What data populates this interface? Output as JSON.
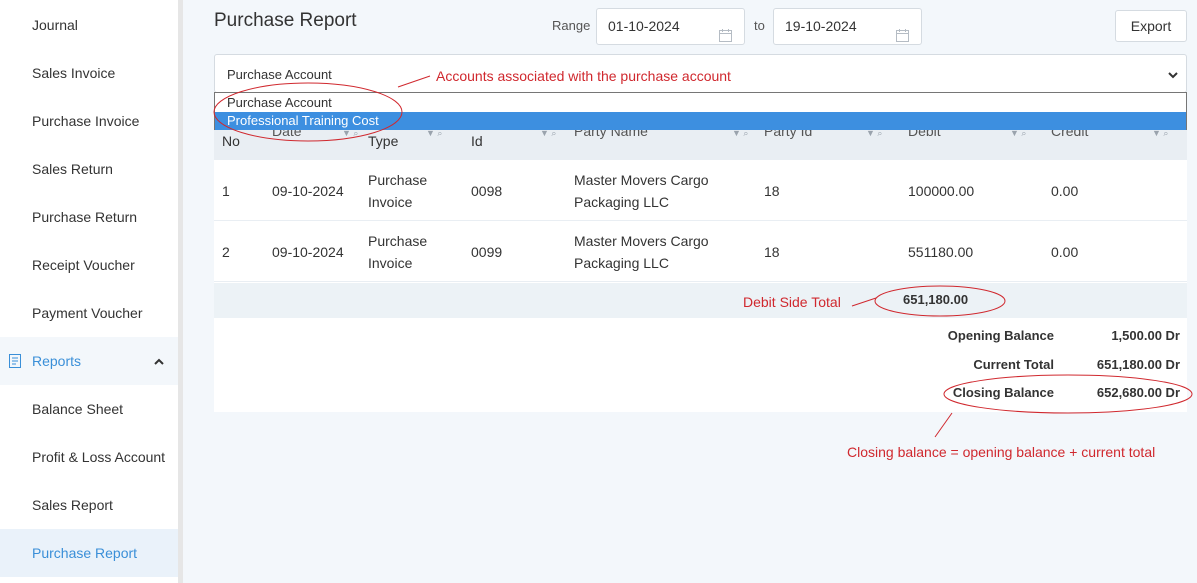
{
  "sidebar": {
    "items": [
      {
        "label": "Journal"
      },
      {
        "label": "Sales Invoice"
      },
      {
        "label": "Purchase Invoice"
      },
      {
        "label": "Sales Return"
      },
      {
        "label": "Purchase Return"
      },
      {
        "label": "Receipt Voucher"
      },
      {
        "label": "Payment Voucher"
      }
    ],
    "reports": {
      "label": "Reports",
      "icon": "report-icon",
      "expanded_icon": "chevron-up-icon"
    },
    "report_items": [
      {
        "label": "Balance Sheet"
      },
      {
        "label": "Profit & Loss Account"
      },
      {
        "label": "Sales Report"
      },
      {
        "label": "Purchase Report",
        "active": true
      }
    ]
  },
  "header": {
    "title": "Purchase Report",
    "range_label": "Range",
    "from_date": "01-10-2024",
    "to_label": "to",
    "to_date": "19-10-2024",
    "export_label": "Export"
  },
  "account_select": {
    "selected": "Purchase Account",
    "options": [
      "Purchase Account",
      "Professional Training Cost"
    ],
    "highlighted": "Professional Training Cost"
  },
  "table": {
    "columns": [
      "No",
      "Date",
      "Type",
      "Id",
      "Party Name",
      "Party Id",
      "Debit",
      "Credit"
    ],
    "rows": [
      {
        "no": "1",
        "date": "09-10-2024",
        "type_1": "Purchase",
        "type_2": "Invoice",
        "id": "0098",
        "party_1": "Master Movers Cargo",
        "party_2": "Packaging LLC",
        "party_id": "18",
        "debit": "100000.00",
        "credit": "0.00"
      },
      {
        "no": "2",
        "date": "09-10-2024",
        "type_1": "Purchase",
        "type_2": "Invoice",
        "id": "0099",
        "party_1": "Master Movers Cargo",
        "party_2": "Packaging LLC",
        "party_id": "18",
        "debit": "551180.00",
        "credit": "0.00"
      }
    ],
    "debit_total": "651,180.00"
  },
  "summary": {
    "opening_label": "Opening Balance",
    "opening_value": "1,500.00 Dr",
    "current_label": "Current Total",
    "current_value": "651,180.00 Dr",
    "closing_label": "Closing Balance",
    "closing_value": "652,680.00 Dr"
  },
  "annotations": {
    "accounts_note": "Accounts associated with the purchase account",
    "debit_note": "Debit Side Total",
    "closing_note": "Closing balance = opening balance + current total",
    "color": "#d0282e"
  },
  "colors": {
    "accent": "#3a8fd8",
    "highlight": "#3d8fe0"
  }
}
